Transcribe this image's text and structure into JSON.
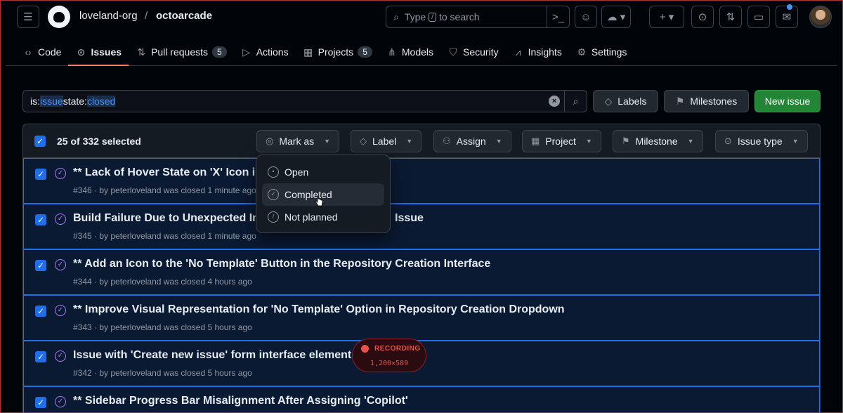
{
  "header": {
    "org": "loveland-org",
    "separator": "/",
    "repo": "octoarcade",
    "search_prefix": "Type",
    "search_key": "/",
    "search_suffix": "to search"
  },
  "tabs": [
    {
      "label": "Code",
      "icon": "code-icon"
    },
    {
      "label": "Issues",
      "icon": "issue-opened-icon",
      "active": true
    },
    {
      "label": "Pull requests",
      "icon": "git-pull-request-icon",
      "count": "5"
    },
    {
      "label": "Actions",
      "icon": "play-icon"
    },
    {
      "label": "Projects",
      "icon": "table-icon",
      "count": "5"
    },
    {
      "label": "Models",
      "icon": "models-icon"
    },
    {
      "label": "Security",
      "icon": "shield-icon"
    },
    {
      "label": "Insights",
      "icon": "graph-icon"
    },
    {
      "label": "Settings",
      "icon": "gear-icon"
    }
  ],
  "filter": {
    "parts": [
      "is:",
      "issue",
      " state:",
      "closed"
    ],
    "labels_button": "Labels",
    "milestones_button": "Milestones",
    "new_issue_button": "New issue"
  },
  "bulk": {
    "selected_text": "25 of 332 selected",
    "mark_as": "Mark as",
    "label": "Label",
    "assign": "Assign",
    "project": "Project",
    "milestone": "Milestone",
    "issue_type": "Issue type"
  },
  "menu": {
    "items": [
      "Open",
      "Completed",
      "Not planned"
    ],
    "hovered": "Completed"
  },
  "issues": [
    {
      "title": "** Lack of Hover State on 'X' Icon in",
      "meta": "#346 · by peterloveland was closed 1 minute ago"
    },
    {
      "title": "Build Failure Due to Unexpected In",
      "title_tail": "Issue",
      "meta": "#345 · by peterloveland was closed 1 minute ago"
    },
    {
      "title": "** Add an Icon to the 'No Template' Button in the Repository Creation Interface",
      "meta": "#344 · by peterloveland was closed 4 hours ago"
    },
    {
      "title": "** Improve Visual Representation for 'No Template' Option in Repository Creation Dropdown",
      "meta": "#343 · by peterloveland was closed 5 hours ago"
    },
    {
      "title": "Issue with 'Create new issue' form interface elements",
      "meta": "#342 · by peterloveland was closed 5 hours ago"
    },
    {
      "title": "** Sidebar Progress Bar Misalignment After Assigning 'Copilot'",
      "meta": ""
    }
  ],
  "recording": {
    "label": "RECORDING",
    "size": "1,200×589"
  },
  "colors": {
    "accent": "#1f6feb",
    "closed": "#ab7df8",
    "primary": "#238636",
    "underline": "#f78166"
  }
}
